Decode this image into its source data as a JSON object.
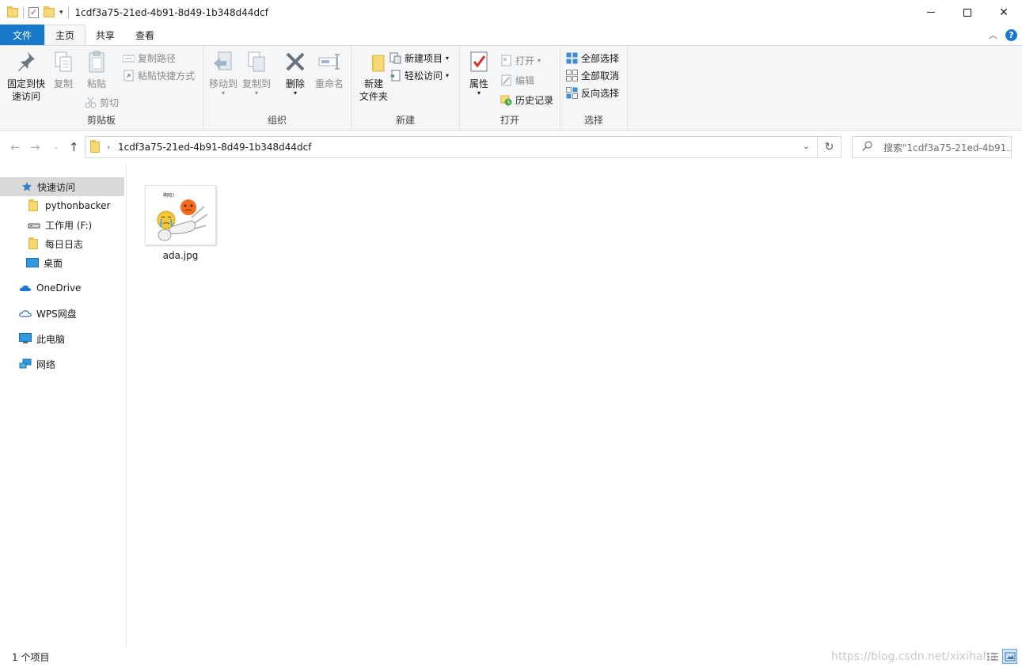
{
  "window": {
    "title": "1cdf3a75-21ed-4b91-8d49-1b348d44dcf",
    "min_glyph": "",
    "max_glyph": "",
    "close_glyph": "✕"
  },
  "tabs": {
    "file": "文件",
    "home": "主页",
    "share": "共享",
    "view": "查看",
    "help_glyph": "?",
    "collapse_glyph": "⌃"
  },
  "ribbon": {
    "clipboard": {
      "label": "剪贴板",
      "pin": "固定到快\n速访问",
      "pin_line1": "固定到快",
      "pin_line2": "速访问",
      "copy": "复制",
      "paste": "粘贴",
      "copy_path": "复制路径",
      "paste_shortcut": "粘贴快捷方式",
      "cut": "剪切"
    },
    "organize": {
      "label": "组织",
      "move_to": "移动到",
      "copy_to": "复制到",
      "delete": "删除",
      "rename": "重命名"
    },
    "new": {
      "label": "新建",
      "new_folder_line1": "新建",
      "new_folder_line2": "文件夹",
      "new_item": "新建项目",
      "easy_access": "轻松访问"
    },
    "open": {
      "label": "打开",
      "properties": "属性",
      "open": "打开",
      "edit": "编辑",
      "history": "历史记录"
    },
    "select": {
      "label": "选择",
      "select_all": "全部选择",
      "select_none": "全部取消",
      "invert": "反向选择"
    }
  },
  "address": {
    "path": "1cdf3a75-21ed-4b91-8d49-1b348d44dcf",
    "search_placeholder": "搜索\"1cdf3a75-21ed-4b91..."
  },
  "nav": {
    "quick_access": "快速访问",
    "items": [
      {
        "label": "pythonbacker",
        "icon": "folder-icon"
      },
      {
        "label": "工作用 (F:)",
        "icon": "drive-icon"
      },
      {
        "label": "每日日志",
        "icon": "folder-icon"
      },
      {
        "label": "桌面",
        "icon": "desktop-icon"
      }
    ],
    "onedrive": "OneDrive",
    "wps": "WPS网盘",
    "this_pc": "此电脑",
    "network": "网络"
  },
  "files": [
    {
      "name": "ada.jpg",
      "thumb_caption": "啊哈！"
    }
  ],
  "status": {
    "count": "1 个项目",
    "watermark": "https://blog.csdn.net/xixihaha"
  },
  "colors": {
    "accent": "#1979ca",
    "folder": "#f8d775",
    "ribbon_bg": "#f5f6f7"
  }
}
